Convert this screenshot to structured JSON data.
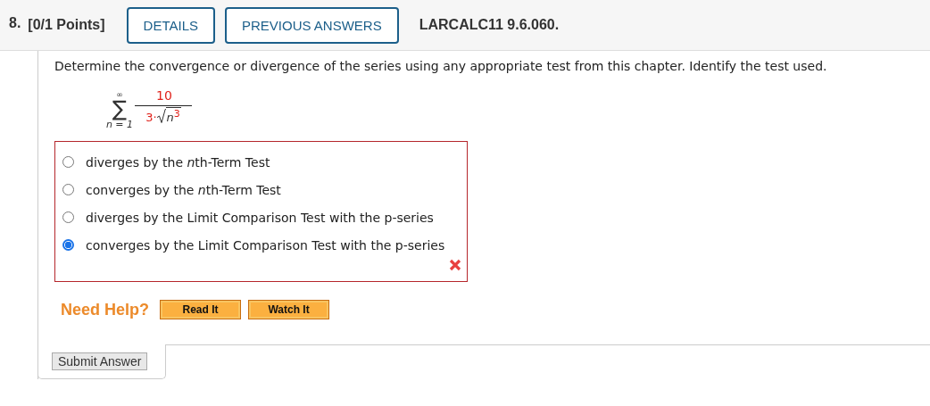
{
  "header": {
    "number": "8.",
    "points": "[0/1 Points]",
    "buttons": [
      "DETAILS",
      "PREVIOUS ANSWERS"
    ],
    "reference": "LARCALC11 9.6.060."
  },
  "question": {
    "prompt": "Determine the convergence or divergence of the series using any appropriate test from this chapter. Identify the test used.",
    "series": {
      "symbol": "∑",
      "upper": "∞",
      "lower": "n = 1",
      "numerator": "10",
      "coefficient": "3·",
      "radicand": "n$^{3}$"
    }
  },
  "answer": {
    "correct": false,
    "options": [
      {
        "label": "diverges by the ",
        "variable": "n",
        "suffix": "th-Term Test",
        "selected": false
      },
      {
        "label": "converges by the ",
        "variable": "n",
        "suffix": "th-Term Test",
        "selected": false
      },
      {
        "label": "diverges by the Limit Comparison Test with the p-series",
        "selected": false
      },
      {
        "label": "converges by the Limit Comparison Test with the p-series",
        "selected": true
      }
    ]
  },
  "help": {
    "label": "Need Help?",
    "buttons": [
      "Read It",
      "Watch It"
    ]
  },
  "submit": {
    "label": "Submit Answer"
  }
}
